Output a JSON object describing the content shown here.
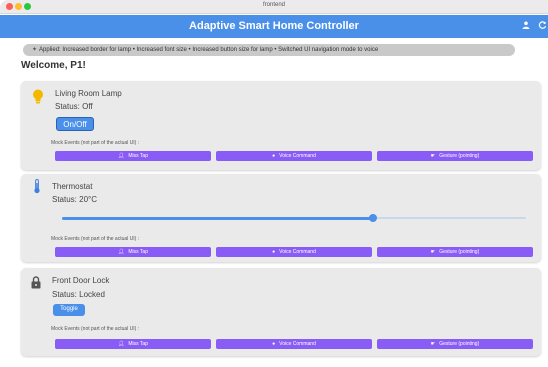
{
  "window": {
    "title": "frontend"
  },
  "appbar": {
    "title": "Adaptive Smart Home Controller",
    "icons": [
      "person-icon",
      "refresh-icon"
    ]
  },
  "banner": {
    "text": "Applied: Increased border for lamp • Increased font size • Increased button size for lamp • Switched UI navigation mode to voice"
  },
  "welcome": "Welcome, P1!",
  "devices": [
    {
      "name": "Living Room Lamp",
      "status": "Status: Off",
      "button": "On/Off",
      "icon": "lightbulb-icon",
      "icon_color": "#f5b800"
    },
    {
      "name": "Thermostat",
      "status": "Status: 20°C",
      "slider_fraction": 0.67,
      "icon": "thermometer-icon",
      "icon_color": "#3f7fe0"
    },
    {
      "name": "Front Door Lock",
      "status": "Status: Locked",
      "button": "Toggle",
      "icon": "lock-icon",
      "icon_color": "#555555"
    }
  ],
  "mock_events": {
    "label": "Mock Events (not part of the actual UI) :",
    "buttons": [
      "Miss Tap",
      "Voice Command",
      "Gesture (pointing)"
    ]
  },
  "colors": {
    "accent": "#4a8fe8",
    "mock": "#8a5cf6",
    "card": "#eaeaea"
  }
}
